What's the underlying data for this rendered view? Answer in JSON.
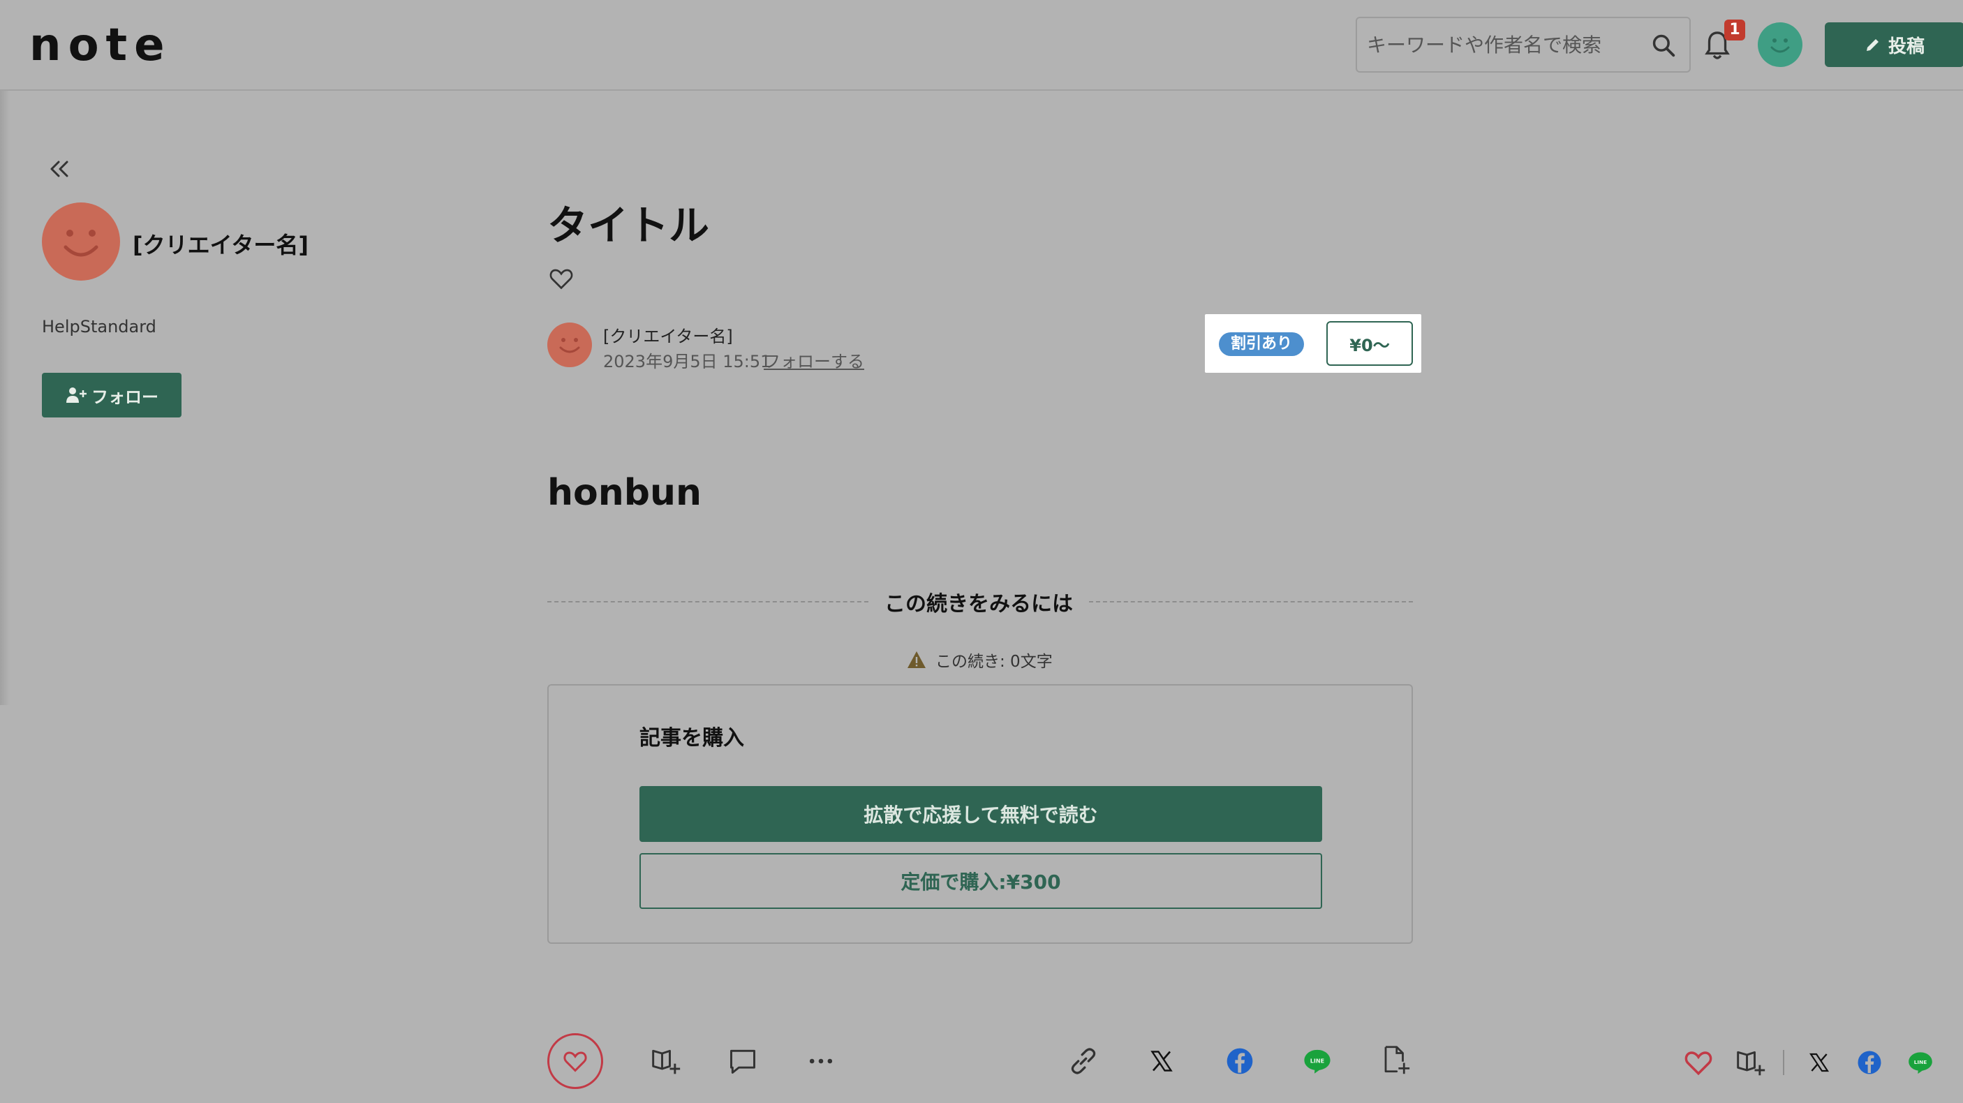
{
  "header": {
    "logo": "note",
    "search_placeholder": "キーワードや作者名で検索",
    "notification_count": "1",
    "post_label": "投稿"
  },
  "sidebar": {
    "creator_name": "[クリエイター名]",
    "description": "HelpStandard",
    "follow_label": "フォロー"
  },
  "article": {
    "title": "タイトル",
    "author_name": "[クリエイター名]",
    "date": "2023年9月5日 15:51",
    "follow_link": "フォローする",
    "discount_badge": "割引あり",
    "price": "¥0〜",
    "body": "honbun",
    "continue_label": "この続きをみるには",
    "continue_count": "この続き: 0文字"
  },
  "purchase": {
    "heading": "記事を購入",
    "free_button": "拡散で応援して無料で読む",
    "buy_button": "定価で購入:¥300"
  },
  "toolbar": {
    "icons": [
      "heart-icon",
      "magazine-add-icon",
      "comment-icon",
      "more-icon",
      "link-icon",
      "x-icon",
      "facebook-icon",
      "line-icon",
      "file-add-icon"
    ],
    "right_icons": [
      "heart-icon",
      "magazine-add-icon",
      "x-icon",
      "facebook-icon",
      "line-icon"
    ],
    "line_text": "LINE"
  },
  "colors": {
    "brand_green": "#2f6553",
    "discount_blue": "#4d8fce",
    "like_red": "#c23a46",
    "badge_red": "#c23b2e",
    "avatar_orange": "#c96a57",
    "avatar_teal": "#3f9e84"
  }
}
